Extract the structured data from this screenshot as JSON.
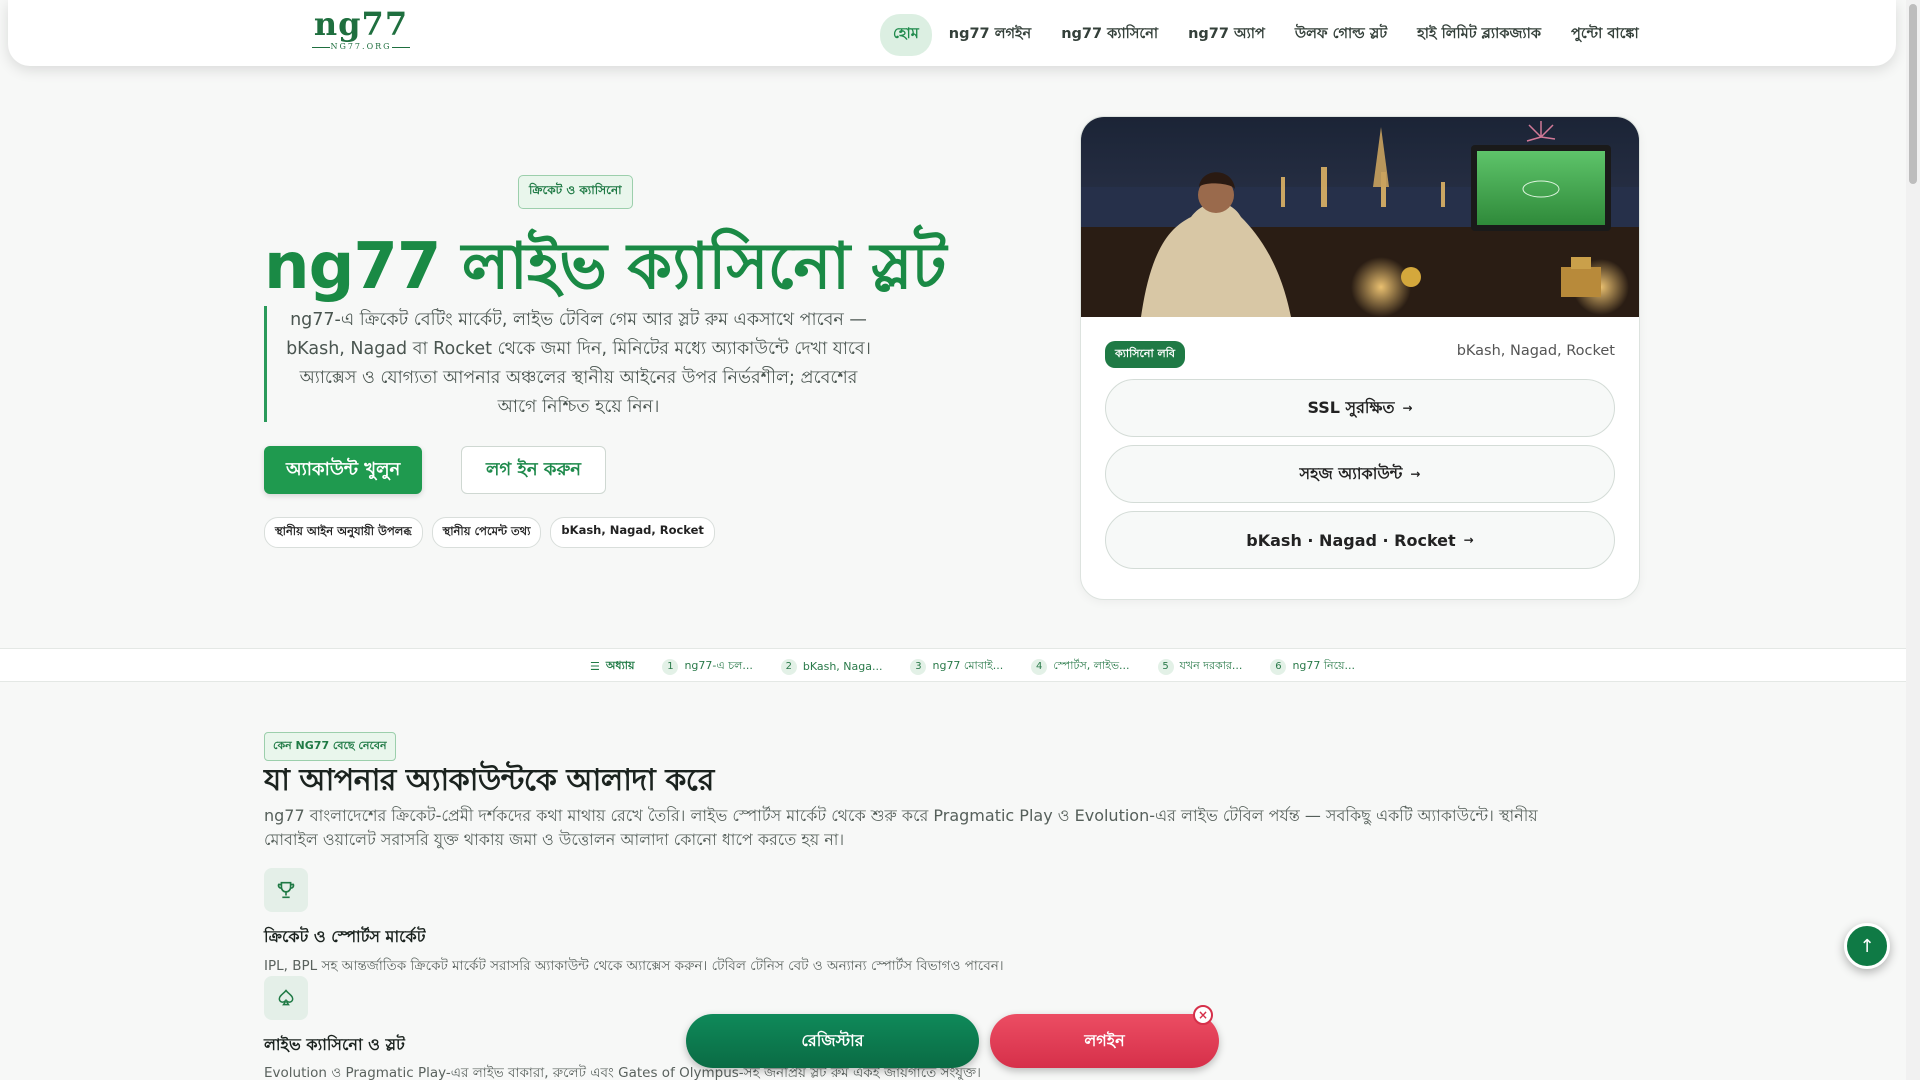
{
  "header": {
    "logo_text": "ng77",
    "logo_sub": "NG77.ORG",
    "nav": [
      {
        "label": "হোম",
        "active": true
      },
      {
        "label": "ng77 লগইন"
      },
      {
        "label": "ng77 ক্যাসিনো"
      },
      {
        "label": "ng77 অ্যাপ"
      },
      {
        "label": "উলফ গোল্ড স্লট"
      },
      {
        "label": "হাই লিমিট ব্ল্যাকজ্যাক"
      },
      {
        "label": "পুন্টো বাঙ্কো"
      }
    ]
  },
  "hero": {
    "tag": "ক্রিকেট ও ক্যাসিনো",
    "title": "ng77 লাইভ ক্যাসিনো স্লট",
    "description": "ng77-এ ক্রিকেট বেটিং মার্কেট, লাইভ টেবিল গেম আর স্লট রুম একসাথে পাবেন — bKash, Nagad বা Rocket থেকে জমা দিন, মিনিটের মধ্যে অ্যাকাউন্টে দেখা যাবে। অ্যাক্সেস ও যোগ্যতা আপনার অঞ্চলের স্থানীয় আইনের উপর নির্ভরশীল; প্রবেশের আগে নিশ্চিত হয়ে নিন।",
    "primary_button": "অ্যাকাউন্ট খুলুন",
    "secondary_button": "লগ ইন করুন",
    "chips": [
      "স্থানীয় আইন অনুযায়ী উপলব্ধ",
      "স্থানীয় পেমেন্ট তথ্য",
      "bKash, Nagad, Rocket"
    ]
  },
  "card": {
    "badge": "ক্যাসিনো লবি",
    "payments": "bKash, Nagad, Rocket",
    "buttons": [
      "SSL সুরক্ষিত",
      "সহজ অ্যাকাউন্ট",
      "bKash · Nagad · Rocket"
    ]
  },
  "chapters": {
    "label": "অধ্যায়",
    "items": [
      {
        "num": "1",
        "label": "ng77-এ চল..."
      },
      {
        "num": "2",
        "label": "bKash, Naga..."
      },
      {
        "num": "3",
        "label": "ng77 মোবাই..."
      },
      {
        "num": "4",
        "label": "স্পোর্টস, লাইভ..."
      },
      {
        "num": "5",
        "label": "যখন দরকার..."
      },
      {
        "num": "6",
        "label": "ng77 নিয়ে..."
      }
    ]
  },
  "features_section": {
    "tag": "কেন NG77 বেছে নেবেন",
    "title": "যা আপনার অ্যাকাউন্টকে আলাদা করে",
    "description": "ng77 বাংলাদেশের ক্রিকেট-প্রেমী দর্শকদের কথা মাথায় রেখে তৈরি। লাইভ স্পোর্টস মার্কেট থেকে শুরু করে Pragmatic Play ও Evolution-এর লাইভ টেবিল পর্যন্ত — সবকিছু একটি অ্যাকাউন্টে। স্থানীয় মোবাইল ওয়ালেট সরাসরি যুক্ত থাকায় জমা ও উত্তোলন আলাদা কোনো ধাপে করতে হয় না।",
    "items": [
      {
        "icon": "trophy-icon",
        "title": "ক্রিকেট ও স্পোর্টস মার্কেট",
        "desc": "IPL, BPL সহ আন্তর্জাতিক ক্রিকেট মার্কেট সরাসরি অ্যাকাউন্ট থেকে অ্যাক্সেস করুন। টেবিল টেনিস বেট ও অন্যান্য স্পোর্টস বিভাগও পাবেন।"
      },
      {
        "icon": "spade-icon",
        "title": "লাইভ ক্যাসিনো ও স্লট",
        "desc": "Evolution ও Pragmatic Play-এর লাইভ বাকারা, রুলেট এবং Gates of Olympus-সহ জনপ্রিয় স্লট রুম একই জায়গাতে সংযুক্ত।"
      }
    ]
  },
  "floating": {
    "register": "রেজিস্টার",
    "login": "লগইন",
    "close": "×",
    "to_top": "↑"
  },
  "colors": {
    "brand_green": "#1f9a4f",
    "login_red": "#d6304a"
  }
}
